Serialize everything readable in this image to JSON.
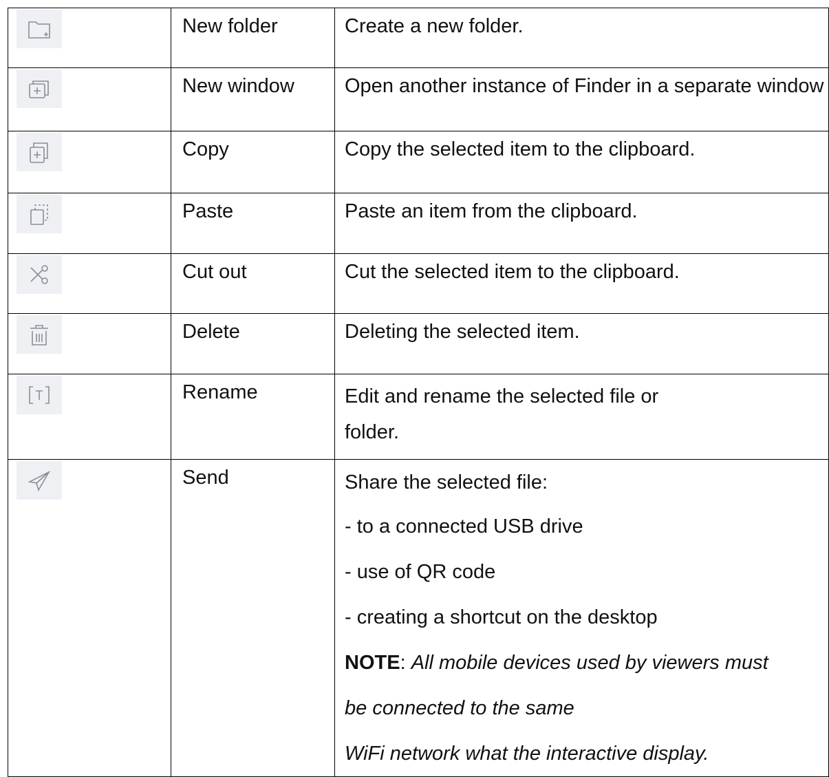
{
  "rows": [
    {
      "icon": "new-folder-icon",
      "name": "New folder",
      "desc": "Create a new folder."
    },
    {
      "icon": "new-window-icon",
      "name": "New window",
      "desc": "Open another instance of Finder in a separate window"
    },
    {
      "icon": "copy-icon",
      "name": "Copy",
      "desc": "Copy the selected item to the clipboard."
    },
    {
      "icon": "paste-icon",
      "name": "Paste",
      "desc": "Paste an item from the clipboard."
    },
    {
      "icon": "scissors-icon",
      "name": "Cut out",
      "desc": "Cut the selected item to the clipboard."
    },
    {
      "icon": "trash-icon",
      "name": "Delete",
      "desc": "Deleting the selected item."
    },
    {
      "icon": "rename-icon",
      "name": "Rename",
      "desc_lines": [
        "Edit and rename the selected file or",
        "folder."
      ]
    },
    {
      "icon": "send-icon",
      "name": "Send",
      "desc_lines": [
        "Share the selected file:",
        "- to a connected USB drive",
        "- use of QR code",
        "- creating a shortcut on the desktop"
      ],
      "note_label": "NOTE",
      "note_sep": ": ",
      "note_lines": [
        "All mobile devices used by viewers must",
        "be connected to the same",
        "WiFi network what the interactive display."
      ]
    }
  ]
}
